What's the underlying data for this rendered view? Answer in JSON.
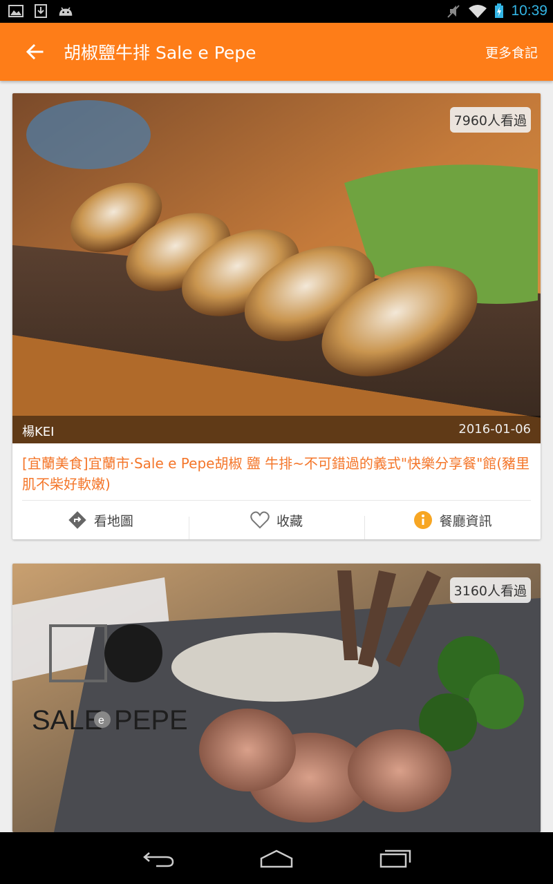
{
  "status_bar": {
    "time": "10:39",
    "icons": [
      "image-icon",
      "download-icon",
      "android-icon",
      "mute-icon",
      "wifi-icon",
      "battery-charging-icon"
    ]
  },
  "app_bar": {
    "title": "胡椒鹽牛排 Sale e Pepe",
    "more_label": "更多食記",
    "back_icon": "arrow-back-icon"
  },
  "cards": [
    {
      "views": "7960人看過",
      "author": "楊KEI",
      "date": "2016-01-06",
      "title": "[宜蘭美食]宜蘭市‧Sale e Pepe胡椒 鹽 牛排~不可錯過的義式\"快樂分享餐\"館(豬里肌不柴好軟嫩)",
      "actions": {
        "map": "看地圖",
        "favorite": "收藏",
        "info": "餐廳資訊"
      }
    },
    {
      "views": "3160人看過",
      "logo_text": "SALE e PEPE"
    }
  ],
  "nav_bar": {
    "icons": [
      "back-nav-icon",
      "home-nav-icon",
      "recents-nav-icon"
    ]
  },
  "colors": {
    "accent": "#fe7d18",
    "title_text": "#f4762a",
    "info_icon": "#f7a623"
  }
}
